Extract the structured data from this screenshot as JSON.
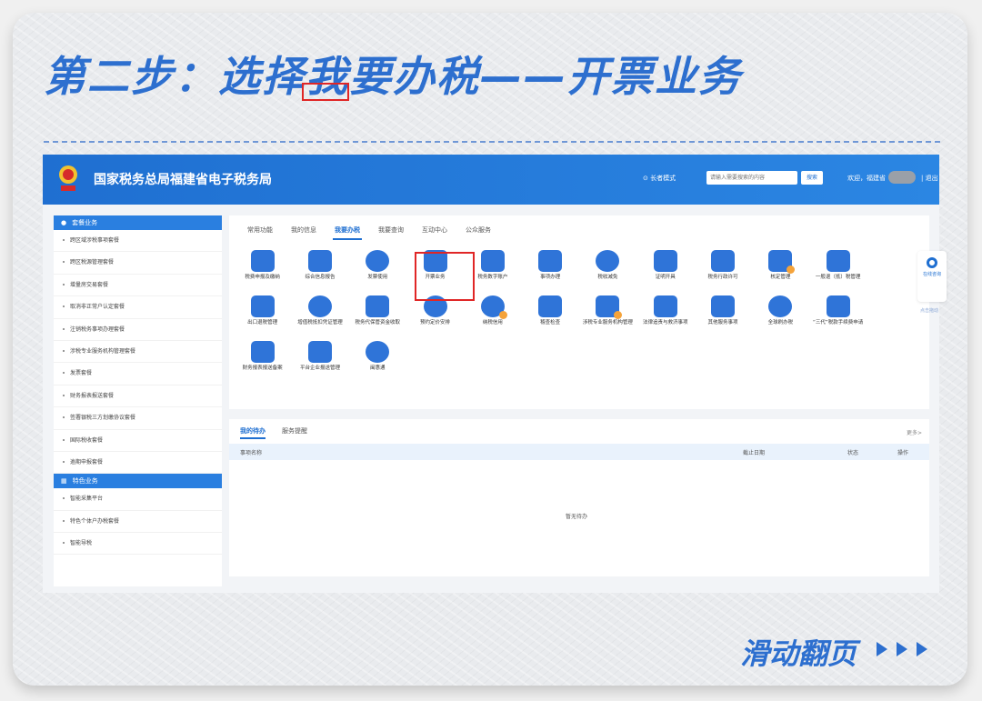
{
  "headline": "第二步：选择我要办税——开票业务",
  "footer": {
    "swipe": "滑动翻页"
  },
  "site": {
    "title": "国家税务总局福建省电子税务局",
    "emblem_text": "中国税务",
    "mode": "⊙ 长者模式",
    "search_placeholder": "请输入需要搜索的内容",
    "search_btn": "搜索",
    "welcome": "欢迎，福建省",
    "logout": "| 退出"
  },
  "sidebar": {
    "section1": "套餐业务",
    "items1": [
      "跨区域涉税事项套餐",
      "跨区税源管理套餐",
      "增量房交易套餐",
      "取消非正常户认定套餐",
      "注销税务事项办理套餐",
      "涉税专业服务机构管理套餐",
      "发票套餐",
      "财务报表报送套餐",
      "签署银税三方划缴协议套餐",
      "国际税收套餐",
      "逾期申报套餐"
    ],
    "section2": "特色业务",
    "items2": [
      "智能采集平台",
      "特色个体户办税套餐",
      "智能导税"
    ]
  },
  "tabs": [
    "常用功能",
    "我的信息",
    "我要办税",
    "我要查询",
    "互动中心",
    "公众服务"
  ],
  "active_tab": 2,
  "functions": [
    "税费申报及缴纳",
    "综合信息报告",
    "发票使用",
    "开票业务",
    "税务数字账户",
    "事项办理",
    "税收减免",
    "证明开具",
    "税务行政许可",
    "核定管理",
    "一般退（抵）税管理",
    "出口退税管理",
    "增值税抵扣凭证管理",
    "税务代保管资金收取",
    "预约定价安排",
    "纳税信用",
    "稽查检查",
    "涉税专业服务机构管理",
    "法律追责与救济事项",
    "其他服务事项",
    "全球刷办税",
    "“三代”税款手续费申请",
    "财务报表报送备案",
    "平台企业报送管理",
    "闽惠通"
  ],
  "float_help": {
    "label": "在线咨询",
    "tip": "点击拖动"
  },
  "todo": {
    "tabs": [
      "我的待办",
      "服务提醒"
    ],
    "more": "更多>",
    "columns": [
      "事项名称",
      "截止日期",
      "状态",
      "操作"
    ],
    "empty": "暂无待办"
  },
  "colors": {
    "brand_blue": "#2d6fcf",
    "highlight_red": "#e02626"
  }
}
